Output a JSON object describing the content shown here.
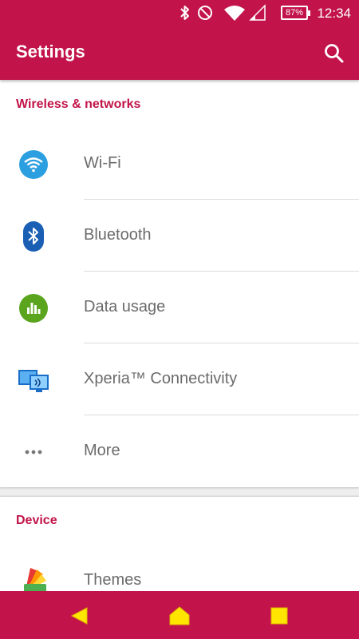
{
  "status_bar": {
    "time": "12:34",
    "battery_percent": "87%",
    "icons": [
      "bluetooth-icon",
      "do-not-disturb-icon",
      "wifi-signal-icon",
      "cellular-signal-icon"
    ]
  },
  "app_bar": {
    "title": "Settings",
    "search_icon": "search-icon"
  },
  "sections": [
    {
      "header": "Wireless & networks",
      "items": [
        {
          "label": "Wi-Fi",
          "icon": "wifi-icon"
        },
        {
          "label": "Bluetooth",
          "icon": "bluetooth-icon"
        },
        {
          "label": "Data usage",
          "icon": "data-usage-icon"
        },
        {
          "label": "Xperia™ Connectivity",
          "icon": "xperia-connectivity-icon"
        },
        {
          "label": "More",
          "icon": "more-icon"
        }
      ]
    },
    {
      "header": "Device",
      "items": [
        {
          "label": "Themes",
          "icon": "themes-icon"
        }
      ]
    }
  ],
  "nav_bar": {
    "buttons": [
      "back-icon",
      "home-icon",
      "recents-icon"
    ]
  },
  "colors": {
    "accent": "#c2144a",
    "nav_button": "#ffe600",
    "text_secondary": "#6b6b6b"
  }
}
